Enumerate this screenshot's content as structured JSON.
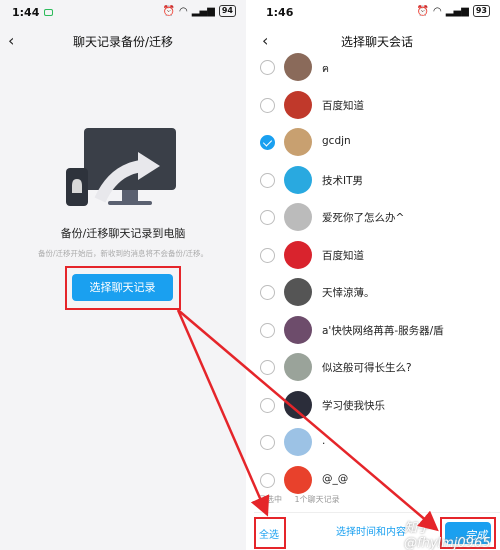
{
  "left": {
    "status": {
      "time": "1:44",
      "battery": "94"
    },
    "title": "聊天记录备份/迁移",
    "headline": "备份/迁移聊天记录到电脑",
    "subline": "备份/迁移开始后，新收到的消息将不会备份/迁移。",
    "button_label": "选择聊天记录"
  },
  "right": {
    "status": {
      "time": "1:46",
      "battery": "93"
    },
    "title": "选择聊天会话",
    "contacts": [
      {
        "name": "ฅ",
        "checked": false,
        "avatar_icon": "avatar-photo-icon",
        "color": "#8a6a5a"
      },
      {
        "name": "百度知道",
        "checked": false,
        "avatar_icon": "avatar-decorative-icon",
        "color": "#c0392b"
      },
      {
        "name": "gcdjn",
        "checked": true,
        "avatar_icon": "avatar-cat-icon",
        "color": "#c8a070"
      },
      {
        "name": "技术IT男",
        "checked": false,
        "avatar_icon": "avatar-panda-icon",
        "color": "#29a9e0"
      },
      {
        "name": "爱死你了怎么办^",
        "checked": false,
        "avatar_icon": "avatar-sketch-icon",
        "color": "#bbbbbb"
      },
      {
        "name": "百度知道",
        "checked": false,
        "avatar_icon": "avatar-text-icon",
        "color": "#d9232d"
      },
      {
        "name": "天悻涼薄。",
        "checked": false,
        "avatar_icon": "avatar-bear-icon",
        "color": "#555555"
      },
      {
        "name": "a'快快网络苒苒-服务器/盾",
        "checked": false,
        "avatar_icon": "avatar-girl-icon",
        "color": "#6d4c6b"
      },
      {
        "name": "似这般可得长生么?",
        "checked": false,
        "avatar_icon": "avatar-pattern-icon",
        "color": "#9aa39a"
      },
      {
        "name": "学习使我快乐",
        "checked": false,
        "avatar_icon": "avatar-dark-icon",
        "color": "#2b2d3a"
      },
      {
        "name": ".",
        "checked": false,
        "avatar_icon": "avatar-anime-icon",
        "color": "#9cc2e5"
      },
      {
        "name": "@_@",
        "checked": false,
        "avatar_icon": "avatar-red-icon",
        "color": "#e8412c"
      }
    ],
    "selected_text": "已选中",
    "count_text": "1个聊天记录",
    "select_all": "全选",
    "bottom_text": "选择时间和内容",
    "watermark": "知乎 @fhylmj0965",
    "confirm_label": "完成"
  },
  "colors": {
    "accent": "#1aa0f0",
    "highlight": "#e5252a"
  }
}
